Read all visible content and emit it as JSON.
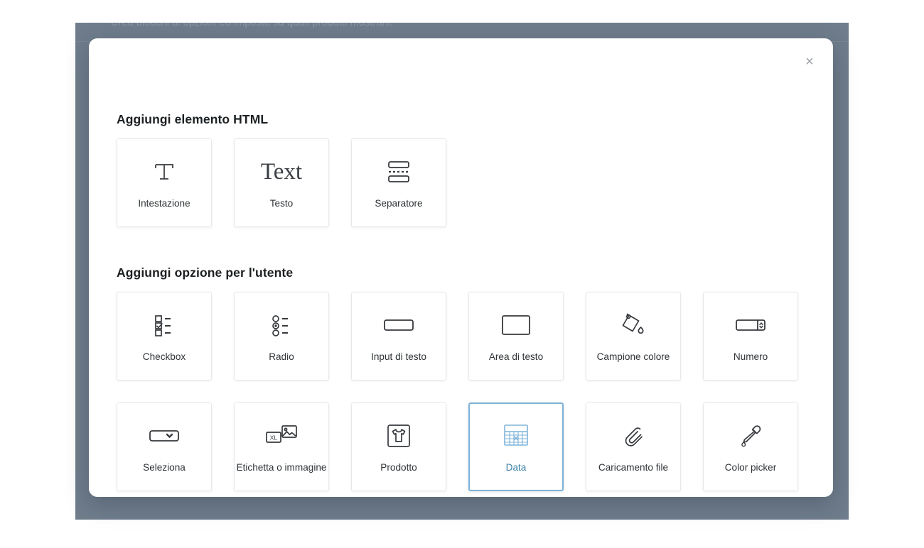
{
  "background_page": {
    "partial_text": "Crea blocchi di opzioni ed imposta su quali prodotti mostrarli."
  },
  "modal": {
    "close_label": "×",
    "close_icon": "close-icon",
    "sections": [
      {
        "id": "html-elements",
        "title": "Aggiungi elemento HTML",
        "cards": [
          {
            "label": "Intestazione",
            "icon": "heading-t-icon",
            "selected": false
          },
          {
            "label": "Testo",
            "icon": "text-serif-icon",
            "selected": false
          },
          {
            "label": "Separatore",
            "icon": "separator-icon",
            "selected": false
          }
        ]
      },
      {
        "id": "user-options",
        "title": "Aggiungi opzione per l'utente",
        "cards": [
          {
            "label": "Checkbox",
            "icon": "checkbox-list-icon",
            "selected": false
          },
          {
            "label": "Radio",
            "icon": "radio-list-icon",
            "selected": false
          },
          {
            "label": "Input di testo",
            "icon": "text-input-icon",
            "selected": false
          },
          {
            "label": "Area di testo",
            "icon": "textarea-icon",
            "selected": false
          },
          {
            "label": "Campione colore",
            "icon": "paint-bucket-icon",
            "selected": false
          },
          {
            "label": "Numero",
            "icon": "number-stepper-icon",
            "selected": false
          },
          {
            "label": "Seleziona",
            "icon": "select-dropdown-icon",
            "selected": false
          },
          {
            "label": "Etichetta o immagine",
            "icon": "label-image-icon",
            "selected": false
          },
          {
            "label": "Prodotto",
            "icon": "product-tshirt-icon",
            "selected": false
          },
          {
            "label": "Data",
            "icon": "calendar-icon",
            "selected": true
          },
          {
            "label": "Caricamento file",
            "icon": "paperclip-icon",
            "selected": false
          },
          {
            "label": "Color picker",
            "icon": "eyedropper-icon",
            "selected": false
          }
        ]
      }
    ]
  },
  "colors": {
    "overlay": "#6f7d8c",
    "modal_bg": "#ffffff",
    "card_border": "#e6e8ea",
    "selected_border": "#7eb3d8",
    "selected_text": "#3a7fa8",
    "icon": "#36393d",
    "title_text": "#1c2023"
  }
}
